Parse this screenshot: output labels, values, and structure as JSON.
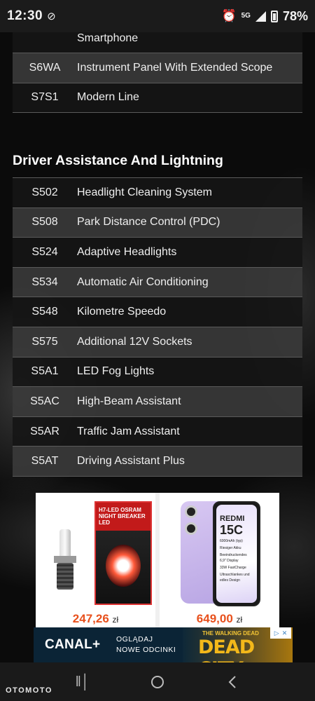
{
  "status_bar": {
    "time": "12:30",
    "network": "5G",
    "battery": "78%"
  },
  "tables": {
    "top": [
      {
        "code": "",
        "desc": "Smartphone"
      },
      {
        "code": "S6WA",
        "desc": "Instrument Panel With Extended Scope"
      },
      {
        "code": "S7S1",
        "desc": "Modern Line"
      }
    ],
    "section_title": "Driver Assistance And Lightning",
    "driver": [
      {
        "code": "S502",
        "desc": "Headlight Cleaning System"
      },
      {
        "code": "S508",
        "desc": "Park Distance Control (PDC)"
      },
      {
        "code": "S524",
        "desc": "Adaptive Headlights"
      },
      {
        "code": "S534",
        "desc": "Automatic Air Conditioning"
      },
      {
        "code": "S548",
        "desc": "Kilometre Speedo"
      },
      {
        "code": "S575",
        "desc": "Additional 12V Sockets"
      },
      {
        "code": "S5A1",
        "desc": "LED Fog Lights"
      },
      {
        "code": "S5AC",
        "desc": "High-Beam Assistant"
      },
      {
        "code": "S5AR",
        "desc": "Traffic Jam Assistant"
      },
      {
        "code": "S5AT",
        "desc": "Driving Assistant Plus"
      }
    ]
  },
  "ads": {
    "product1": {
      "price": "247,26",
      "currency": "zł",
      "box_label": "H7-LED OSRAM NIGHT BREAKER LED"
    },
    "product2": {
      "price": "649,00",
      "currency": "zł",
      "brand": "REDMI",
      "model": "15C",
      "specs": [
        "6000mAh (typ)",
        "Riesiger Akku",
        "Beeindruckendes 6,9\" Display",
        "33W FastCharge",
        "Ultraschlankes und edles Design"
      ]
    },
    "canal": {
      "logo": "CANAL+",
      "line1": "OGLĄDAJ",
      "line2": "NOWE ODCINKI",
      "show_small": "THE WALKING DEAD",
      "show": "DEAD CITY"
    }
  },
  "navbar": {
    "brand": "OTOMOTO"
  }
}
